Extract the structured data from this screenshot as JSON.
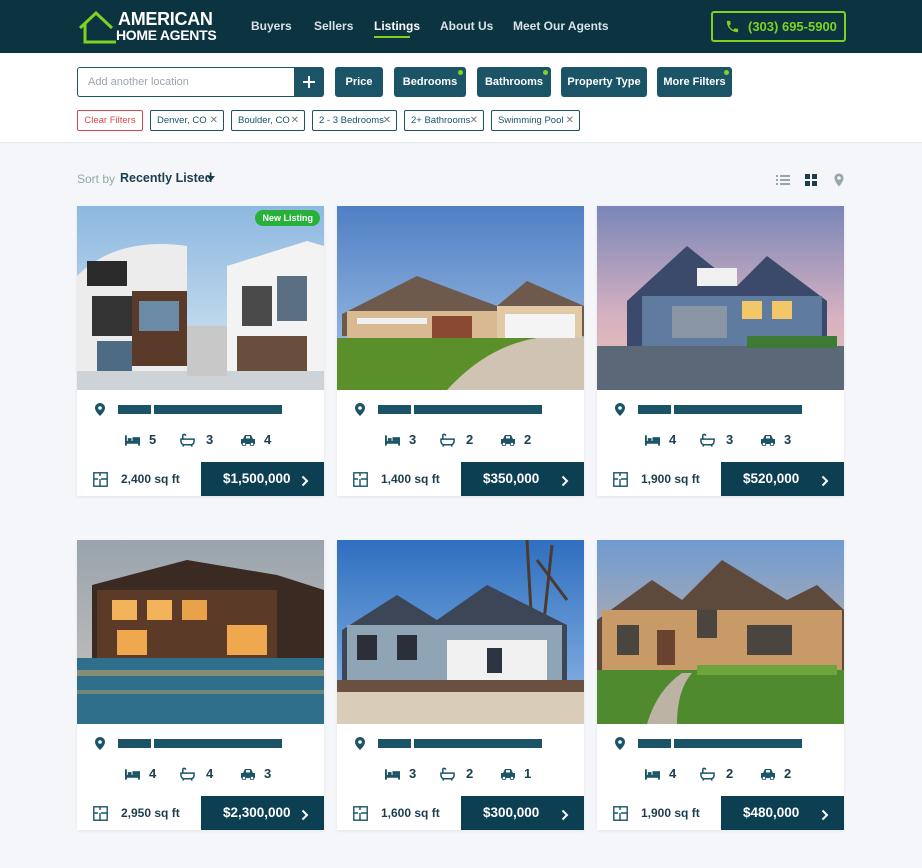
{
  "brand": {
    "line1": "AMERICAN",
    "line2": "HOME AGENTS"
  },
  "nav": {
    "items": [
      "Buyers",
      "Sellers",
      "Listings",
      "About Us",
      "Meet Our Agents"
    ],
    "active": "Listings"
  },
  "phone": "(303) 695-5900",
  "search": {
    "placeholder": "Add another location"
  },
  "filter_buttons": [
    "Price",
    "Bedrooms",
    "Bathrooms",
    "Property Type",
    "More Filters"
  ],
  "chips": [
    "Denver, CO",
    "Boulder, CO",
    "2 - 3 Bedrooms",
    "2+ Bathrooms",
    "Swimming Pool"
  ],
  "clear_filters": "Clear Filters",
  "sort": {
    "label": "Sort by",
    "value": "Recently Listed"
  },
  "colors": {
    "navy": "#0c3340",
    "accent": "#7ed321",
    "button": "#1a5466",
    "new_badge": "#27b13a"
  },
  "listings": [
    {
      "beds": "5",
      "baths": "3",
      "cars": "4",
      "sqft": "2,400 sq ft",
      "price": "$1,500,000",
      "badge": "New Listing"
    },
    {
      "beds": "3",
      "baths": "2",
      "cars": "2",
      "sqft": "1,400 sq ft",
      "price": "$350,000"
    },
    {
      "beds": "4",
      "baths": "3",
      "cars": "3",
      "sqft": "1,900 sq ft",
      "price": "$520,000"
    },
    {
      "beds": "4",
      "baths": "4",
      "cars": "3",
      "sqft": "2,950 sq ft",
      "price": "$2,300,000"
    },
    {
      "beds": "3",
      "baths": "2",
      "cars": "1",
      "sqft": "1,600 sq ft",
      "price": "$300,000"
    },
    {
      "beds": "4",
      "baths": "2",
      "cars": "2",
      "sqft": "1,900 sq ft",
      "price": "$480,000"
    }
  ]
}
